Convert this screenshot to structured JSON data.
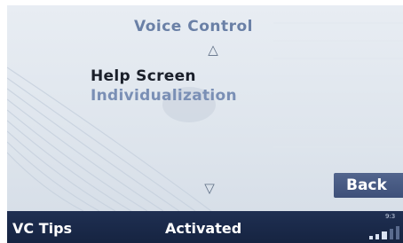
{
  "screen": {
    "title": "Voice Control",
    "menu": [
      {
        "label": "Help Screen",
        "selected": true
      },
      {
        "label": "Individualization",
        "selected": false
      }
    ],
    "scroll_up_symbol": "△",
    "scroll_down_symbol": "▽",
    "back_button_label": "Back"
  },
  "statusbar": {
    "left_label": "VC Tips",
    "center_label": "Activated",
    "time_text": "9:3"
  },
  "colors": {
    "title": "#6a80a6",
    "selected_item": "#1a1f2a",
    "unselected_item": "#7a8fb5",
    "statusbar_bg": "#1f2f52",
    "back_button_bg": "#4a5d86"
  }
}
